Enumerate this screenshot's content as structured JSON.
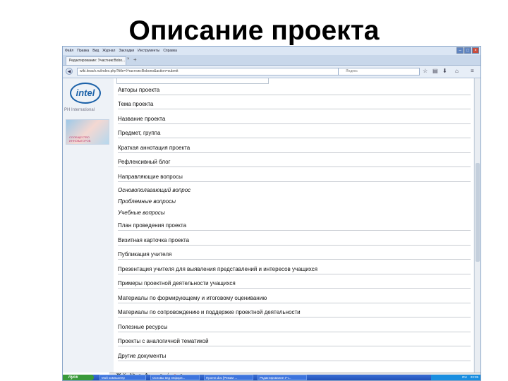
{
  "slide": {
    "title": "Описание проекта"
  },
  "browser": {
    "menu": [
      "Файл",
      "Правка",
      "Вид",
      "Журнал",
      "Закладки",
      "Инструменты",
      "Справка"
    ],
    "tab_title": "Редактирование: Участник:Bobo...",
    "url": "wiki.iteach.ru/index.php?title=Участник:Bobono&action=submit",
    "search_placeholder": "Яндекс"
  },
  "sidebar": {
    "logo": "intel",
    "sublogo": "PH International",
    "banner_text": "СООБЩЕСТВО ИННОВАТОРОВ"
  },
  "sections": [
    "Авторы проекта",
    "Тема проекта",
    "Название проекта",
    "Предмет, группа",
    "Краткая аннотация проекта",
    "Рефлексивный блог",
    "Направляющие вопросы",
    "Основополагающий вопрос",
    "Проблемные вопросы",
    "Учебные вопросы",
    "План проведения проекта",
    "Визитная карточка проекта",
    "Публикация учителя",
    "Презентация учителя для выявления представлений и интересов учащихся",
    "Примеры проектной деятельности учащихся",
    "Материалы по формирующему и итоговому оцениванию",
    "Материалы по сопровождению и поддержке проектной деятельности",
    "Полезные ресурсы",
    "Проекты с аналогичной тематикой",
    "Другие документы"
  ],
  "taskbar": {
    "start": "пуск",
    "items": [
      "Мой компьютер",
      "Основы вед инфори...",
      "Проект.doc [Режим ...",
      "Редактирование Уч..."
    ],
    "lang": "RU",
    "time": "23:35"
  }
}
